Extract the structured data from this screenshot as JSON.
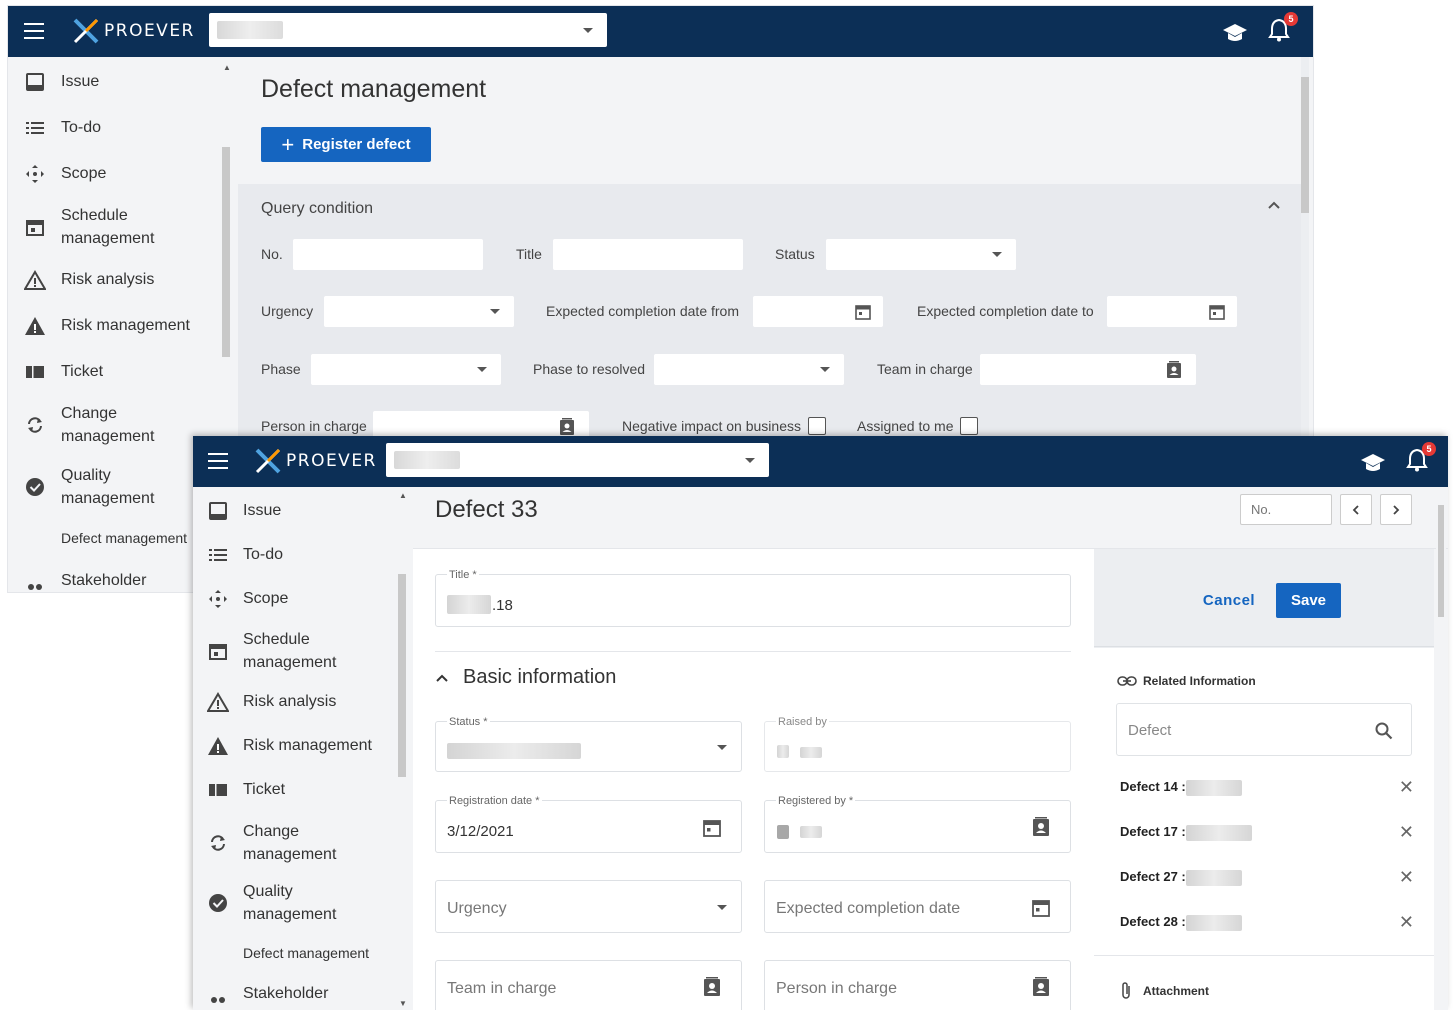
{
  "brand": {
    "logo_text": "PROEVER"
  },
  "notifications": {
    "count": "5"
  },
  "screen1": {
    "sidebar": {
      "items": [
        {
          "label": "Issue",
          "icon": "issue-icon"
        },
        {
          "label": "To-do",
          "icon": "list-icon"
        },
        {
          "label": "Scope",
          "icon": "move-icon"
        },
        {
          "label": "Schedule management",
          "icon": "calendar-icon"
        },
        {
          "label": "Risk analysis",
          "icon": "warning-outline-icon"
        },
        {
          "label": "Risk management",
          "icon": "warning-filled-icon"
        },
        {
          "label": "Ticket",
          "icon": "ticket-icon"
        },
        {
          "label": "Change management",
          "icon": "sync-icon"
        },
        {
          "label": "Quality management",
          "icon": "verified-icon"
        }
      ],
      "sub_item": "Defect management",
      "last_item": "Stakeholder"
    },
    "title": "Defect management",
    "register_button": "Register defect",
    "query": {
      "title": "Query condition",
      "no_label": "No.",
      "title_label": "Title",
      "status_label": "Status",
      "urgency_label": "Urgency",
      "date_from_label": "Expected completion date from",
      "date_to_label": "Expected completion date to",
      "phase_label": "Phase",
      "phase_resolved_label": "Phase to resolved",
      "team_label": "Team in charge",
      "person_label": "Person in charge",
      "negative_label": "Negative impact on business",
      "assigned_label": "Assigned to me"
    }
  },
  "screen2": {
    "sidebar": {
      "items": [
        {
          "label": "Issue"
        },
        {
          "label": "To-do"
        },
        {
          "label": "Scope"
        },
        {
          "label": "Schedule management"
        },
        {
          "label": "Risk analysis"
        },
        {
          "label": "Risk management"
        },
        {
          "label": "Ticket"
        },
        {
          "label": "Change management"
        },
        {
          "label": "Quality management"
        }
      ],
      "sub_item": "Defect management",
      "last_item": "Stakeholder"
    },
    "title": "Defect 33",
    "nav": {
      "no_placeholder": "No."
    },
    "form": {
      "title_label": "Title *",
      "title_value_suffix": ".18",
      "section_title": "Basic information",
      "status_label": "Status *",
      "raised_by_label": "Raised by",
      "reg_date_label": "Registration date *",
      "reg_date_value": "3/12/2021",
      "registered_by_label": "Registered by *",
      "urgency_placeholder": "Urgency",
      "expected_date_placeholder": "Expected completion date",
      "team_placeholder": "Team in charge",
      "person_placeholder": "Person in charge"
    },
    "actions": {
      "cancel": "Cancel",
      "save": "Save"
    },
    "related": {
      "title": "Related Information",
      "search_placeholder": "Defect",
      "items": [
        "Defect 14 :",
        "Defect 17 :",
        "Defect 27 :",
        "Defect 28 :"
      ],
      "attachment_title": "Attachment"
    }
  }
}
